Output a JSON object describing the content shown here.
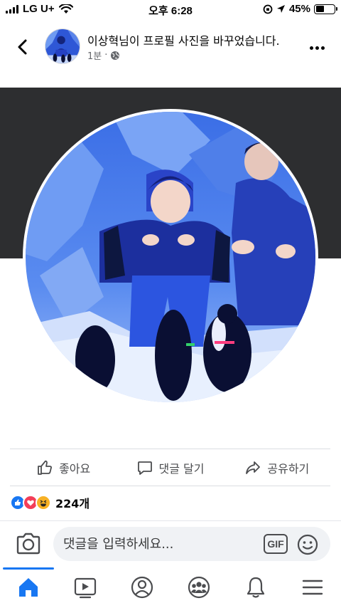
{
  "status_bar": {
    "carrier": "LG U+",
    "time": "오후 6:28",
    "battery": "45%",
    "battery_level": 0.45
  },
  "post": {
    "title": "이상혁님이 프로필 사진을 바꾸었습니다.",
    "time_ago": "1분",
    "separator": "·",
    "privacy_icon": "globe-icon"
  },
  "actions": {
    "like_label": "좋아요",
    "comment_label": "댓글 달기",
    "share_label": "공유하기"
  },
  "reactions": {
    "types": [
      "like",
      "love",
      "haha"
    ],
    "count": "224개"
  },
  "comment_bar": {
    "placeholder": "댓글을 입력하세요...",
    "gif_label": "GIF"
  },
  "bottom_nav": {
    "items": [
      "home-icon",
      "watch-icon",
      "profile-icon",
      "groups-icon",
      "notifications-icon",
      "menu-icon"
    ],
    "active": "home-icon"
  },
  "colors": {
    "accent": "#1877f2",
    "love": "#f33e58",
    "haha": "#f7b125",
    "cover": "#2d2e30"
  }
}
